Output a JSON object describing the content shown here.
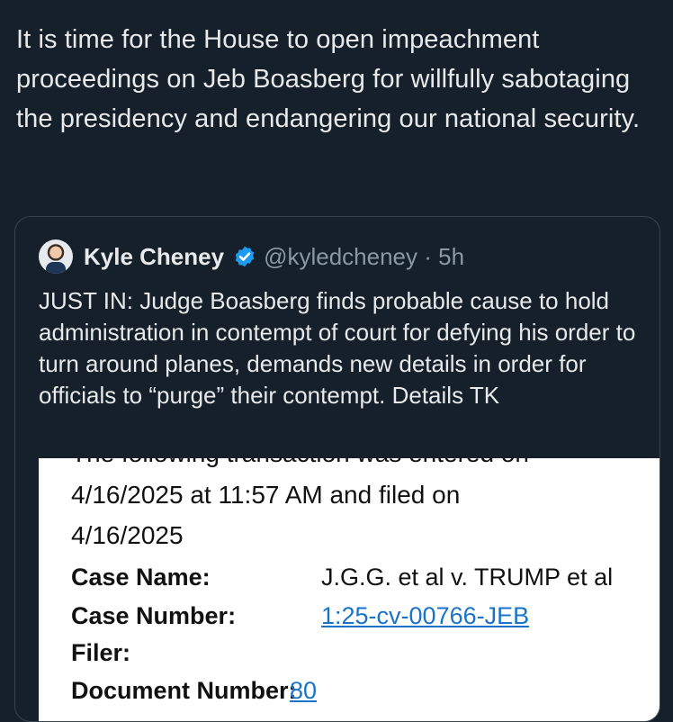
{
  "tweet": {
    "text": "It is time for the House to open impeachment proceedings on Jeb Boasberg for willfully sabotaging the presidency and endangering our national security."
  },
  "quote": {
    "author_name": "Kyle Cheney",
    "handle_time": "@kyledcheney · 5h",
    "verified": true,
    "text": "JUST IN: Judge Boasberg finds probable cause to hold administration in contempt of court for defying his order to turn around planes, demands new details in order for officials to “purge” their contempt. Details TK"
  },
  "document": {
    "cutoff_line": "The following transaction was entered on",
    "line1": "4/16/2025 at 11:57 AM and filed on",
    "line2": "4/16/2025",
    "fields": [
      {
        "label": "Case Name:",
        "value": "J.G.G. et al v. TRUMP et al"
      },
      {
        "label": "Case Number:",
        "value": "1:25-cv-00766-JEB"
      },
      {
        "label": "Filer:",
        "value": ""
      },
      {
        "label": "Document Number:",
        "value": "80"
      }
    ]
  },
  "colors": {
    "background": "#15202b",
    "text": "#e7e9ea",
    "secondary_text": "#8b98a5",
    "verified": "#1d9bf0",
    "link": "#1a73c8"
  }
}
